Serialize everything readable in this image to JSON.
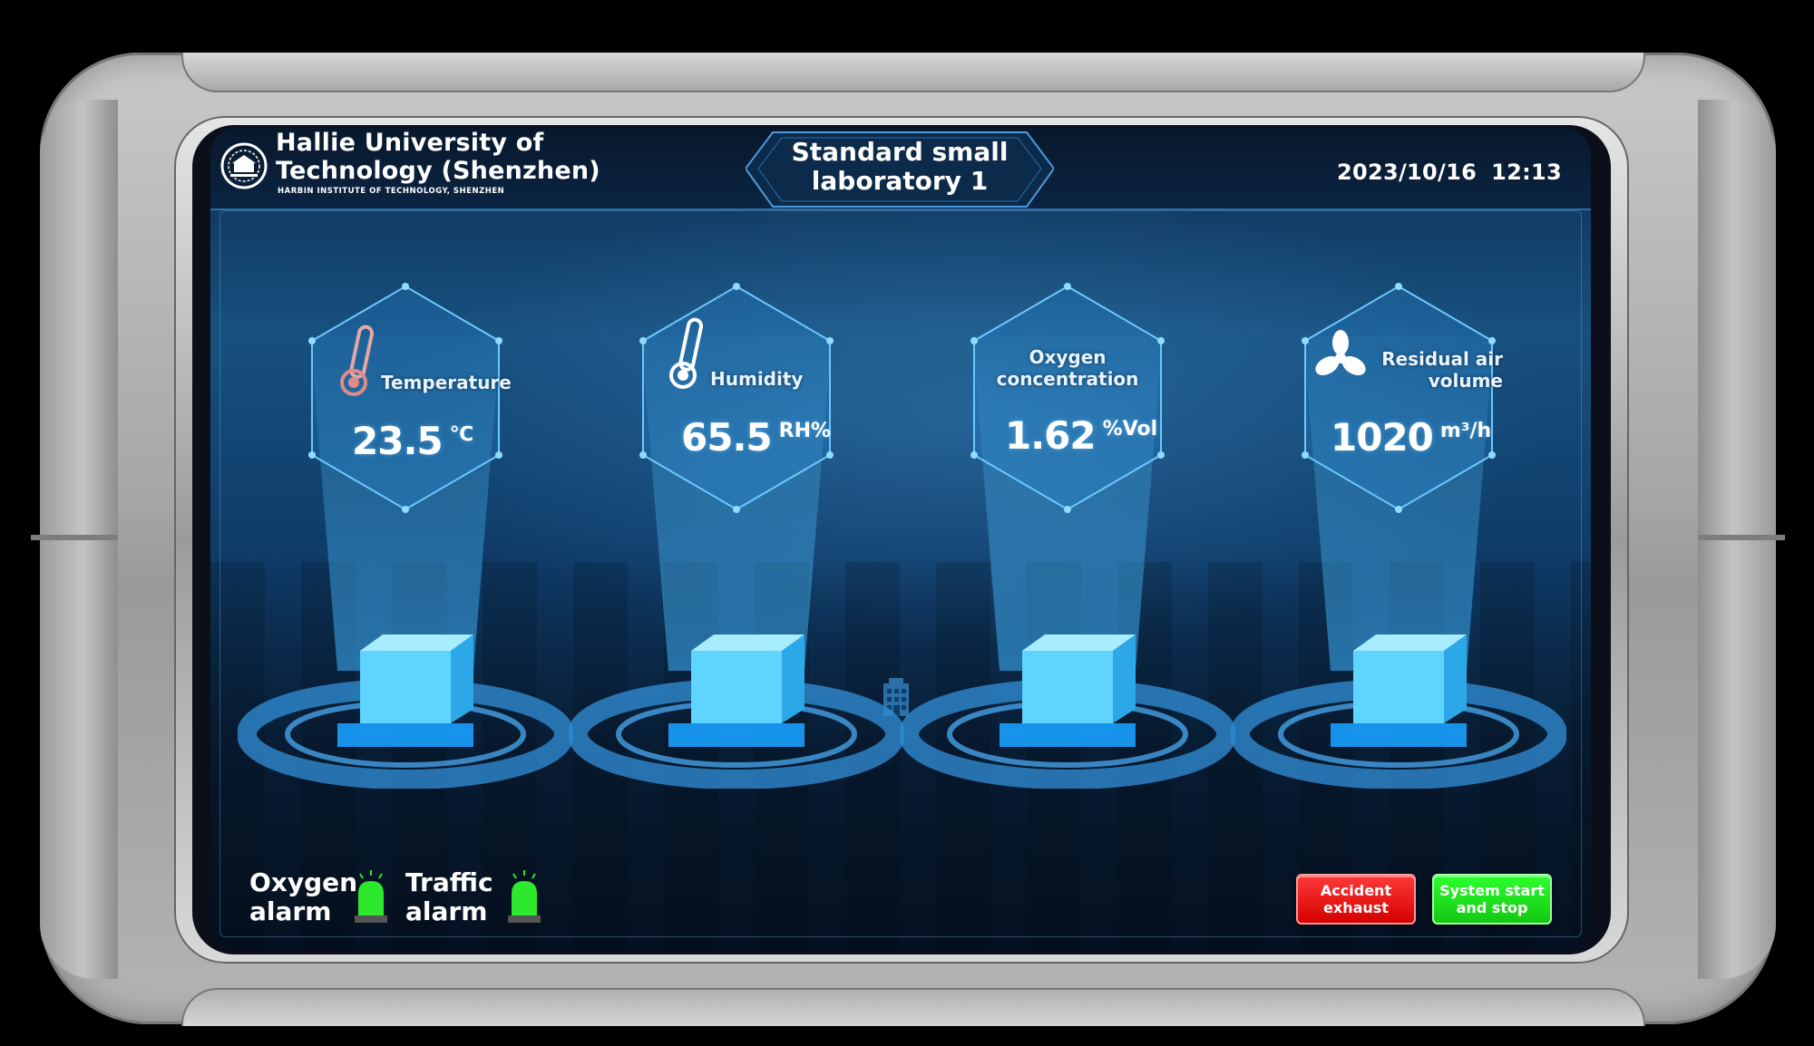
{
  "header": {
    "university_name": "Hallie University of\nTechnology (Shenzhen)",
    "university_subtitle": "HARBIN INSTITUTE OF TECHNOLOGY, SHENZHEN",
    "page_title": "Standard small\nlaboratory 1",
    "date": "2023/10/16",
    "time": "12:13"
  },
  "metrics": [
    {
      "label": "Temperature",
      "value": "23.5",
      "unit": "℃",
      "icon": "thermometer-icon"
    },
    {
      "label": "Humidity",
      "value": "65.5",
      "unit": "RH%",
      "icon": "thermometer-icon"
    },
    {
      "label": "Oxygen\nconcentration",
      "value": "1.62",
      "unit": "%Vol",
      "icon": ""
    },
    {
      "label": "Residual air\nvolume",
      "value": "1020",
      "unit": "m³/h",
      "icon": "fan-icon"
    }
  ],
  "alarms": [
    {
      "label": "Oxygen\nalarm",
      "status_color": "#2ee82e"
    },
    {
      "label": "Traffic\nalarm",
      "status_color": "#2ee82e"
    }
  ],
  "buttons": {
    "accident_exhaust": "Accident\nexhaust",
    "system_start_stop": "System start\nand stop"
  },
  "colors": {
    "accent": "#2e6fa8",
    "danger": "#e00000",
    "ok": "#1fd81f"
  }
}
